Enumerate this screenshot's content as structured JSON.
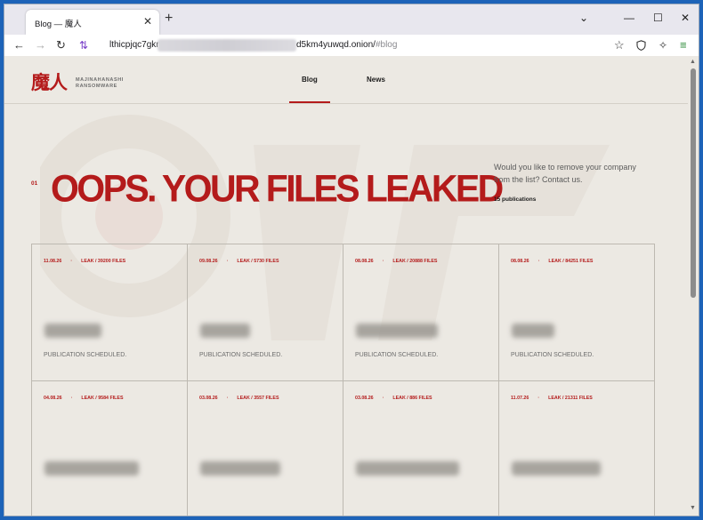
{
  "browser": {
    "tab_title": "Blog — 魔人",
    "tab_close": "✕",
    "new_tab": "+",
    "controls": {
      "dropdown": "⌄",
      "minimize": "—",
      "maximize": "☐",
      "close": "✕"
    },
    "url_prefix": "lthicpjqc7gkn",
    "url_suffix": "d5km4yuwqd.onion/",
    "url_hash": "#blog"
  },
  "site": {
    "logo": "魔人",
    "brand_line1": "MAJINAHANASHI",
    "brand_line2": "RANSOMWARE",
    "nav": [
      {
        "label": "Blog",
        "active": true
      },
      {
        "label": "News",
        "active": false
      }
    ]
  },
  "hero": {
    "number": "01",
    "title": "OOPS. YOUR FILES LEAKED",
    "description": "Would you like to remove your company from the list? Contact us.",
    "count": "15 publications"
  },
  "cards": [
    {
      "date": "11.08.26",
      "leak": "LEAK / 39200 FILES",
      "status": "PUBLICATION SCHEDULED."
    },
    {
      "date": "09.08.26",
      "leak": "LEAK / 5730 FILES",
      "status": "PUBLICATION SCHEDULED."
    },
    {
      "date": "08.08.26",
      "leak": "LEAK / 20888 FILES",
      "status": "PUBLICATION SCHEDULED."
    },
    {
      "date": "08.08.26",
      "leak": "LEAK / 84251 FILES",
      "status": "PUBLICATION SCHEDULED."
    },
    {
      "date": "04.08.26",
      "leak": "LEAK / 9584 FILES",
      "status": ""
    },
    {
      "date": "03.08.26",
      "leak": "LEAK / 3557 FILES",
      "status": ""
    },
    {
      "date": "03.08.26",
      "leak": "LEAK / 886 FILES",
      "status": ""
    },
    {
      "date": "11.07.26",
      "leak": "LEAK / 21311 FILES",
      "status": ""
    }
  ],
  "colors": {
    "accent": "#b41b1b",
    "page_bg": "#ece9e3",
    "frame": "#1d63b8"
  }
}
